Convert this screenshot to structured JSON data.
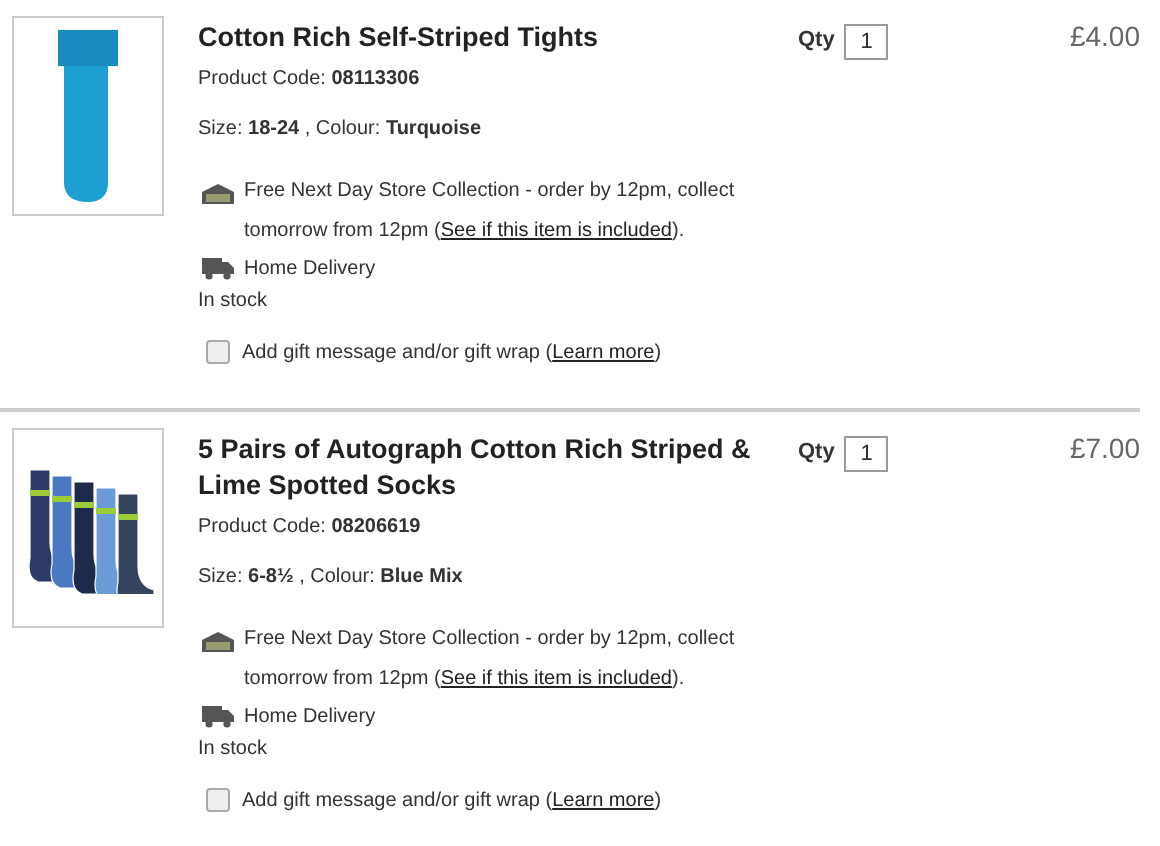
{
  "items": [
    {
      "kind": "tights",
      "title": "Cotton Rich Self-Striped Tights",
      "code_label": "Product Code:",
      "code": "08113306",
      "details": "Size: **18-24** , Colour: **Turquoise**",
      "collection_before": "Free Next Day Store Collection - order by 12pm, collect tomorrow from 12pm (",
      "collection_link": "See if this item is included",
      "collection_after": ").",
      "delivery": "Home Delivery",
      "stock": "In stock",
      "gift_checked": false,
      "gift_before": "Add gift message and/or gift wrap (",
      "gift_link": "Learn more",
      "gift_after": ")",
      "qty_label": "Qty",
      "qty": "1",
      "price": "£4.00"
    },
    {
      "kind": "socks",
      "title": "5 Pairs of Autograph Cotton Rich Striped & Lime Spotted Socks",
      "code_label": "Product Code:",
      "code": "08206619",
      "details": "Size: **6-8½** , Colour: **Blue Mix**",
      "collection_before": "Free Next Day Store Collection - order by 12pm, collect tomorrow from 12pm (",
      "collection_link": "See if this item is included",
      "collection_after": ").",
      "delivery": "Home Delivery",
      "stock": "In stock",
      "gift_checked": false,
      "gift_before": "Add gift message and/or gift wrap (",
      "gift_link": "Learn more",
      "gift_after": ")",
      "qty_label": "Qty",
      "qty": "1",
      "price": "£7.00"
    }
  ]
}
